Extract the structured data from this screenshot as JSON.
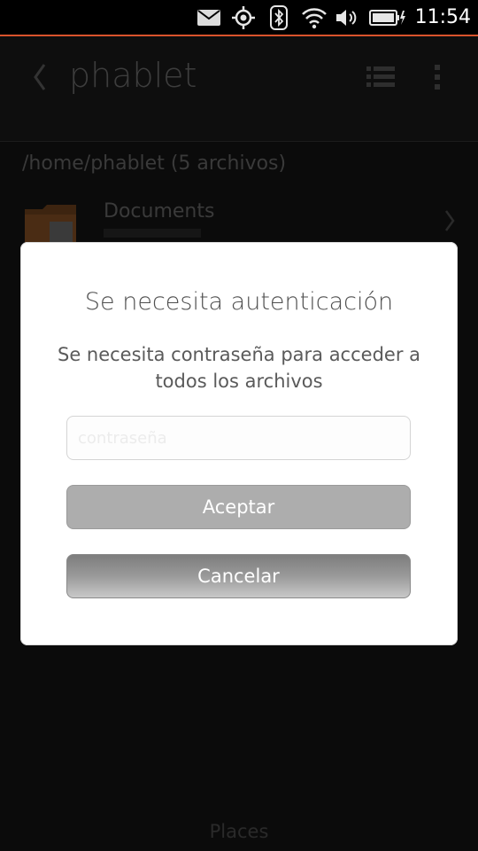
{
  "status_bar": {
    "time": "11:54",
    "icons": [
      "mail-icon",
      "location-icon",
      "bluetooth-icon",
      "wifi-icon",
      "volume-icon",
      "battery-charging-icon"
    ]
  },
  "header": {
    "title": "phablet",
    "back_icon": "back-chevron-icon",
    "list_icon": "list-view-icon",
    "menu_icon": "overflow-menu-icon"
  },
  "content": {
    "path": "/home/phablet (5 archivos)",
    "folder": {
      "name": "Documents",
      "icon": "folder-icon"
    },
    "bottom_label": "Places"
  },
  "dialog": {
    "title": "Se necesita autenticación",
    "message": "Se necesita contraseña para acceder a todos los archivos",
    "password_placeholder": "contraseña",
    "password_value": "",
    "accept_label": "Aceptar",
    "cancel_label": "Cancelar"
  }
}
